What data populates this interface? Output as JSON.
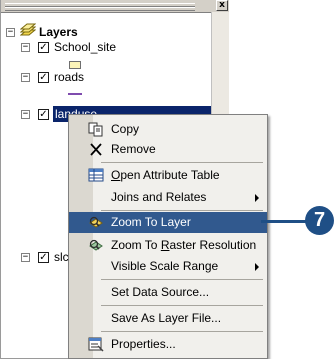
{
  "toc": {
    "title_close": "x",
    "root": {
      "label": "Layers",
      "expander": "−"
    },
    "layers": [
      {
        "label": "School_site",
        "checked": true,
        "expander": "−"
      },
      {
        "label": "roads",
        "checked": true,
        "expander": "−"
      },
      {
        "label": "landuse",
        "checked": true,
        "expander": "−",
        "selected": true
      },
      {
        "label": "slc",
        "checked": true,
        "expander": "−"
      }
    ],
    "check_mark": "✓",
    "school_symbol_color": "#fdf5b9",
    "roads_symbol_color": "#7f4cae",
    "landuse_swatches": [
      "#4fbf7a",
      "#a7d8c7",
      "#e3545a",
      "#5f9fe0",
      "#f29d3a",
      "#2a8a4f",
      "#c9a5d6"
    ]
  },
  "context_menu": {
    "items": [
      {
        "label": "Copy",
        "icon": "copy-icon"
      },
      {
        "label": "Remove",
        "icon": "remove-icon"
      },
      {
        "label_prefix": "",
        "label_u": "O",
        "label_rest": "pen Attribute Table",
        "icon": "table-icon"
      },
      {
        "label": "Joins and Relates",
        "submenu": true
      },
      {
        "label": "Zoom To Layer",
        "icon": "zoom-to-layer-icon",
        "highlighted": true
      },
      {
        "label_prefix": "Zoom To ",
        "label_u": "R",
        "label_rest": "aster Resolution",
        "icon": "zoom-raster-icon"
      },
      {
        "label": "Visible Scale Range",
        "submenu": true
      },
      {
        "label": "Set Data Source..."
      },
      {
        "label": "Save As Layer File..."
      },
      {
        "label": "Properties...",
        "icon": "properties-icon"
      }
    ]
  },
  "callout": {
    "number": "7",
    "color": "#1f4f86"
  }
}
